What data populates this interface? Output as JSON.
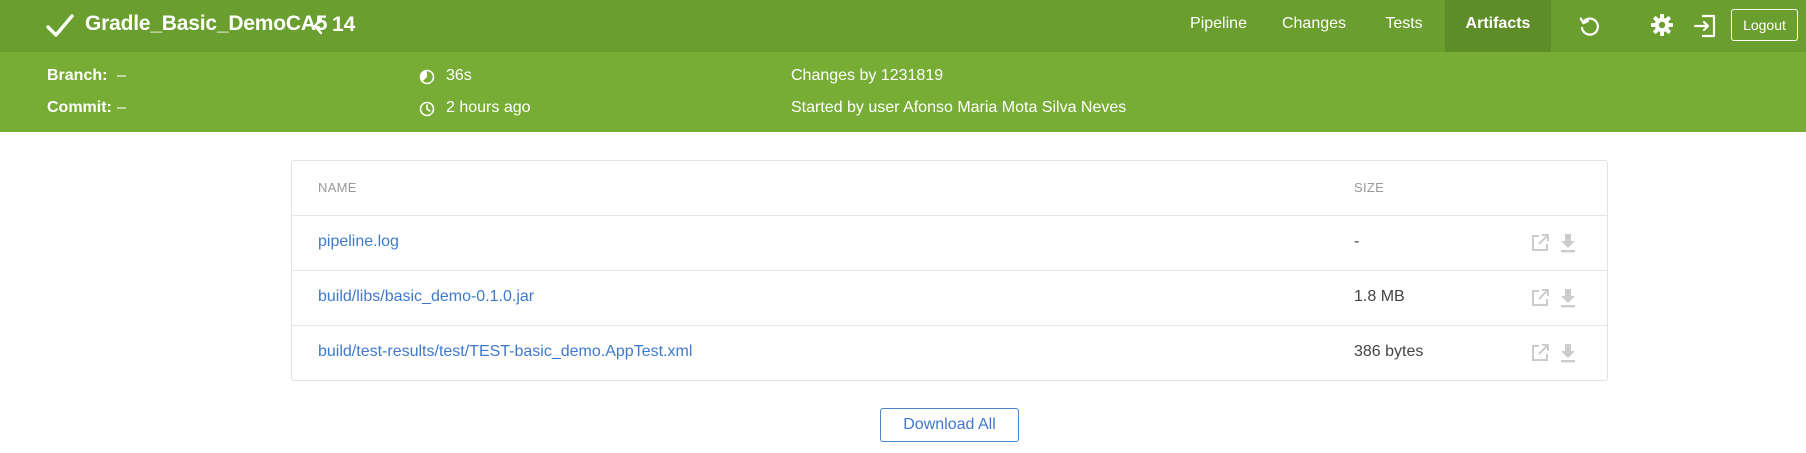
{
  "header": {
    "status_icon": "check-icon",
    "pipeline_name": "Gradle_Basic_DemoCA5",
    "run_number": "14",
    "tabs": [
      {
        "label": "Pipeline",
        "active": false
      },
      {
        "label": "Changes",
        "active": false
      },
      {
        "label": "Tests",
        "active": false
      },
      {
        "label": "Artifacts",
        "active": true
      }
    ],
    "icons": [
      "replay-icon",
      "gear-icon",
      "exit-icon"
    ],
    "logout_label": "Logout"
  },
  "meta": {
    "branch_label": "Branch:",
    "branch_value": "–",
    "commit_label": "Commit:",
    "commit_value": "–",
    "duration": "36s",
    "time_ago": "2 hours ago",
    "changes_by": "Changes by 1231819",
    "started_by": "Started by user Afonso Maria Mota Silva Neves"
  },
  "artifacts": {
    "col_name": "NAME",
    "col_size": "SIZE",
    "rows": [
      {
        "name": "pipeline.log",
        "size": "-"
      },
      {
        "name": "build/libs/basic_demo-0.1.0.jar",
        "size": "1.8 MB"
      },
      {
        "name": "build/test-results/test/TEST-basic_demo.AppTest.xml",
        "size": "386 bytes"
      }
    ],
    "download_all_label": "Download All"
  },
  "colors": {
    "header_bg": "#6a9e2e",
    "meta_bg": "#77ad35",
    "link": "#3f79cc"
  }
}
